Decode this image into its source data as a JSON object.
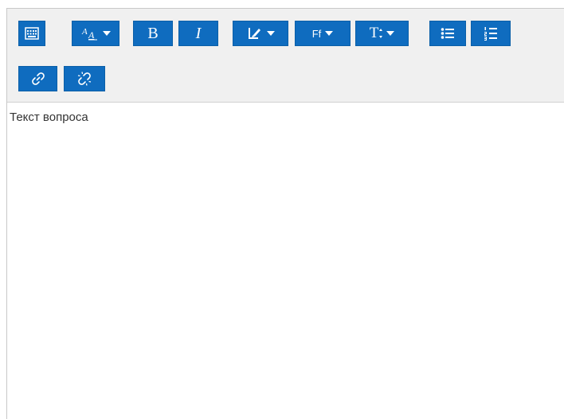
{
  "toolbar": {
    "bold_label": "B",
    "italic_label": "I",
    "font_family_label": "Ff",
    "font_size_label": "T"
  },
  "editor": {
    "content_text": "Текст вопроса"
  },
  "colors": {
    "button_bg": "#0f6cbf",
    "toolbar_bg": "#f0f0f0",
    "text": "#333333"
  }
}
